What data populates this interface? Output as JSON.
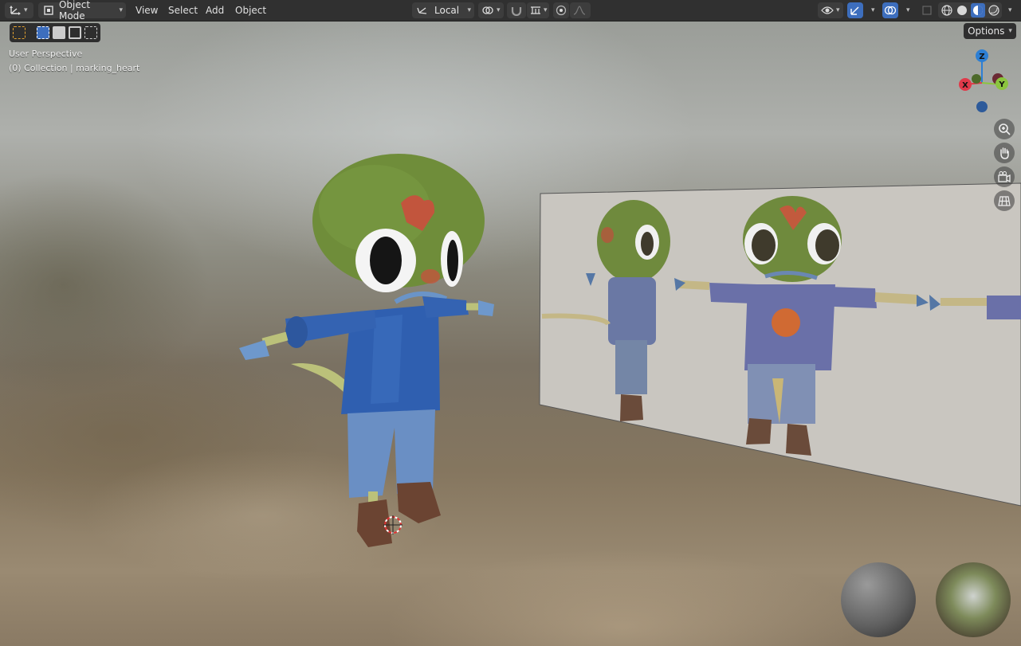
{
  "header": {
    "editor_type_icon": "transform-axes-icon",
    "mode": {
      "label": "Object Mode",
      "icon": "object-mode-icon"
    },
    "menus": [
      "View",
      "Select",
      "Add",
      "Object"
    ],
    "transform_orientation": {
      "label": "Local",
      "icon": "local-orientation-icon"
    },
    "pivot_icon": "pivot-link-icon",
    "snap_icons": [
      "snap-magnet-icon",
      "snap-increment-icon"
    ],
    "proportional_icons": [
      "proportional-editing-icon",
      "proportional-falloff-icon"
    ],
    "right_icons": [
      "visibility-eye-icon",
      "gizmo-toggle-icon",
      "overlay-toggle-icon",
      "xray-toggle-icon",
      "wireframe-shading-icon",
      "solid-shading-icon",
      "material-shading-icon",
      "rendered-shading-icon"
    ]
  },
  "toolbar": {
    "select_modes": [
      "tweak-select-icon",
      "box-select-new-icon",
      "box-select-extend-icon",
      "box-select-subtract-icon",
      "box-select-intersect-icon"
    ]
  },
  "viewport": {
    "perspective_label": "User Perspective",
    "collection_label": "(0) Collection | marking_heart",
    "options_label": "Options",
    "gizmo": {
      "x": "X",
      "y": "Y",
      "z": "Z"
    },
    "nav_icons": [
      "zoom-icon",
      "pan-hand-icon",
      "camera-view-icon",
      "grid-ortho-icon"
    ]
  },
  "colors": {
    "active_blue": "#3d6ebd",
    "axis_x": "#e03a4a",
    "axis_y": "#8bc53f",
    "axis_z": "#2d7fd4"
  }
}
